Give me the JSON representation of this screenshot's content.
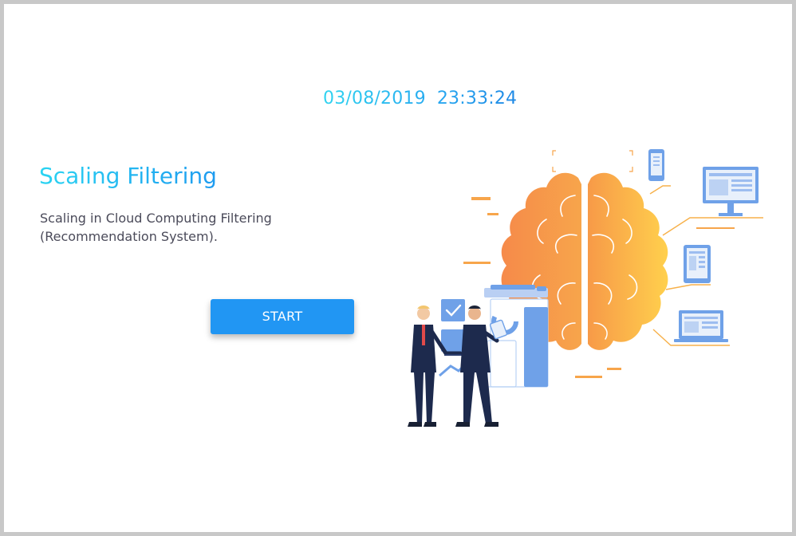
{
  "datetime": {
    "date": "03/08/2019",
    "time": "23:33:24"
  },
  "main": {
    "title": "Scaling Filtering",
    "subtitle": "Scaling in Cloud Computing Filtering (Recommendation System).",
    "start_label": "START"
  },
  "illustration": {
    "icon": "ai-brain-illustration",
    "colors": {
      "brain": "#f7a14b",
      "brain_highlight": "#ffd04d",
      "devices": "#6fa1e8",
      "suits": "#1d2a4d"
    }
  }
}
